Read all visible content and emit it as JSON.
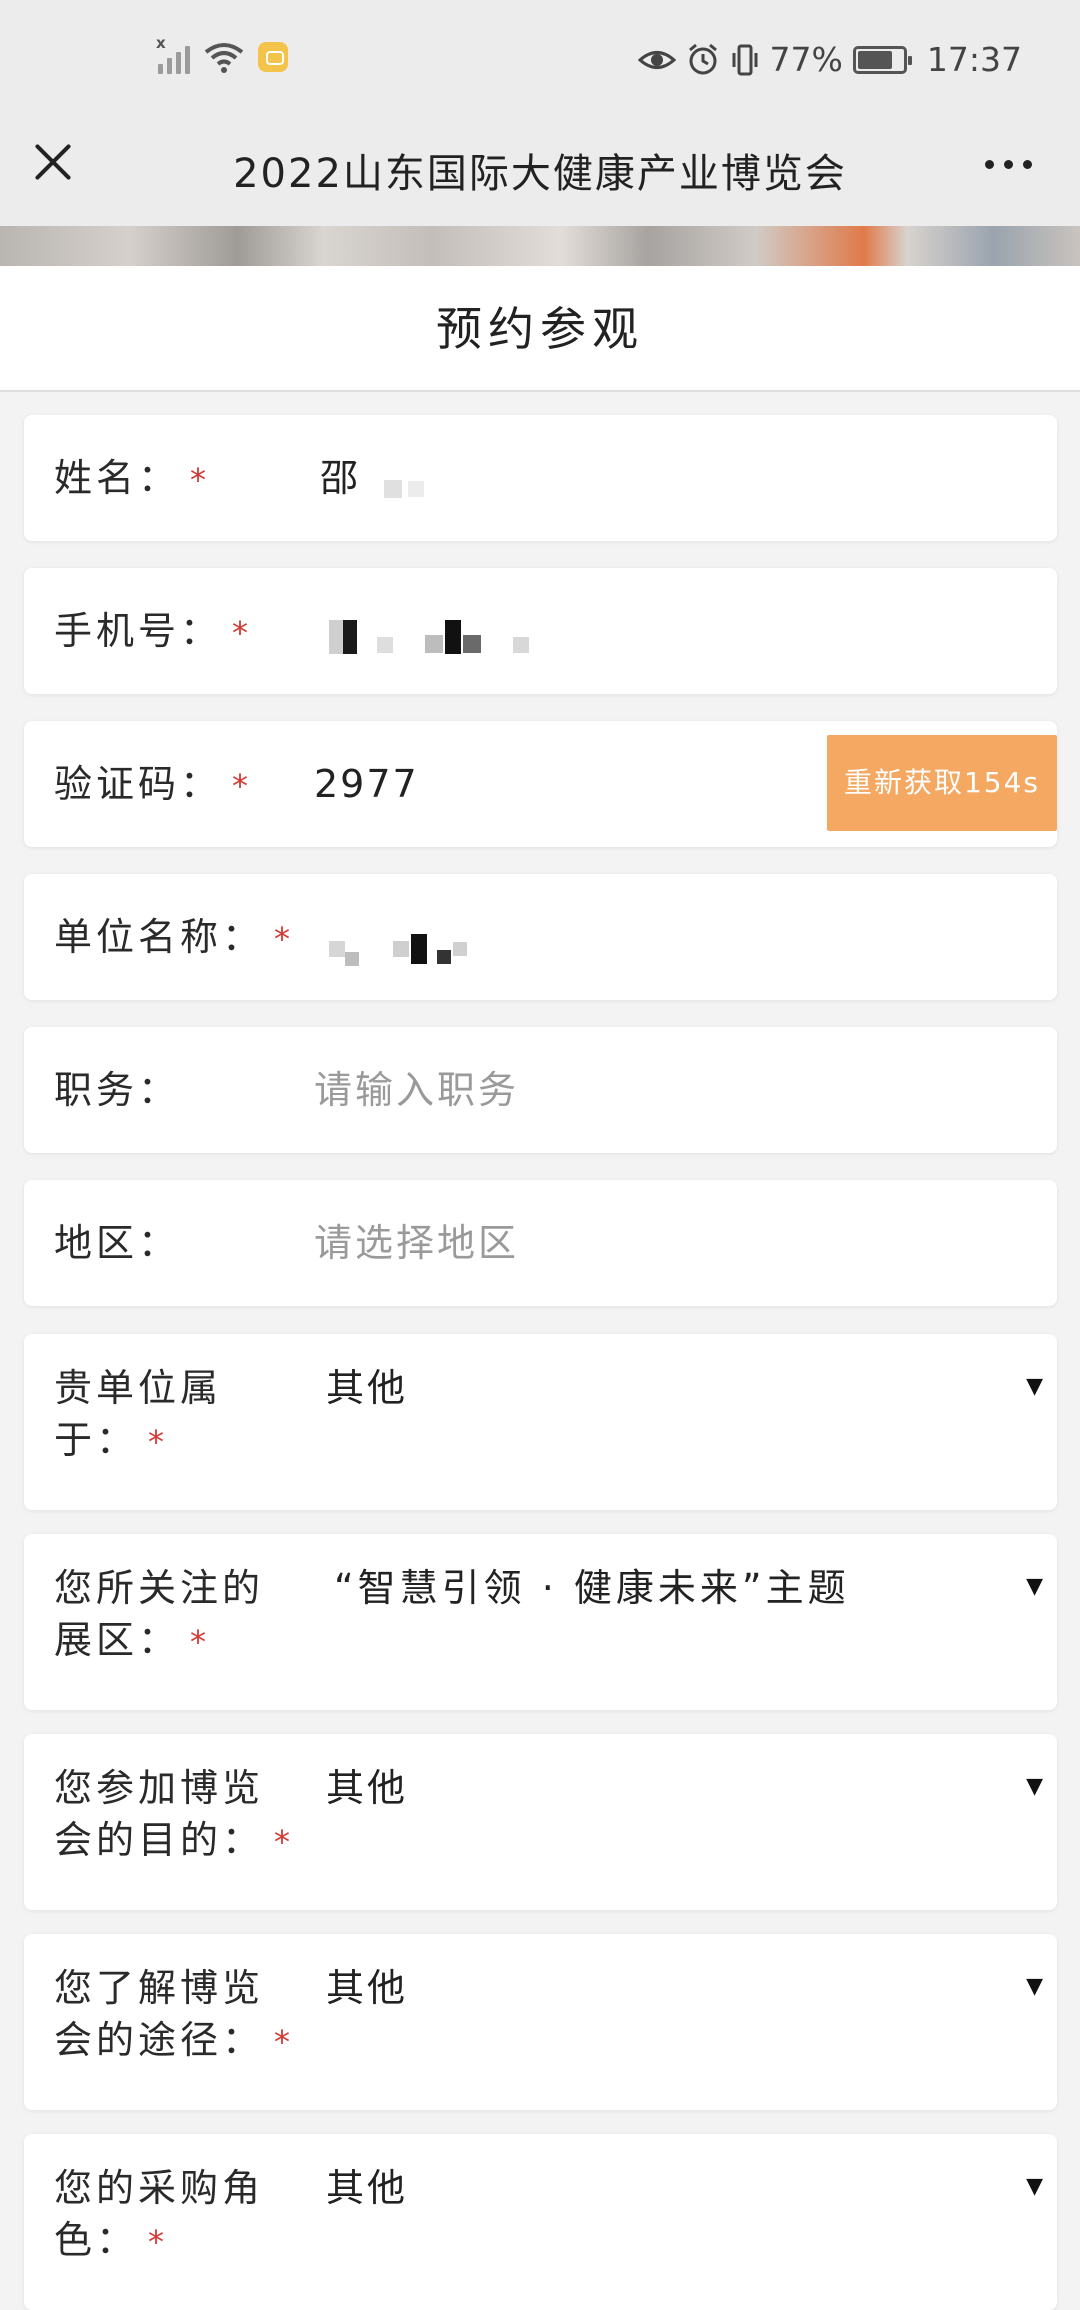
{
  "status_bar": {
    "battery_percent": "77%",
    "time": "17:37",
    "icons": [
      "signal-icon",
      "wifi-icon",
      "notification-icon",
      "eye-icon",
      "alarm-icon",
      "vibrate-icon",
      "battery-icon"
    ]
  },
  "nav": {
    "title": "2022山东国际大健康产业博览会"
  },
  "header": {
    "title": "预约参观"
  },
  "form": {
    "name": {
      "label": "姓名：",
      "required": "*",
      "value": "邵"
    },
    "phone": {
      "label": "手机号：",
      "required": "*"
    },
    "code": {
      "label": "验证码：",
      "required": "*",
      "value": "2977",
      "resend_label": "重新获取154s"
    },
    "company": {
      "label": "单位名称：",
      "required": "*"
    },
    "position": {
      "label": "职务：",
      "placeholder": "请输入职务"
    },
    "region": {
      "label": "地区：",
      "placeholder": "请选择地区"
    },
    "affiliation": {
      "label_line1": "贵单位属",
      "label_line2": "于：",
      "required": "*",
      "value": "其他",
      "caret": "▼"
    },
    "zone": {
      "label_line1": "您所关注的",
      "label_line2": "展区：",
      "required": "*",
      "value": "“智慧引领 · 健康未来”主题",
      "caret": "▼"
    },
    "purpose": {
      "label_line1": "您参加博览",
      "label_line2": "会的目的：",
      "required": "*",
      "value": "其他",
      "caret": "▼"
    },
    "channel": {
      "label_line1": "您了解博览",
      "label_line2": "会的途径：",
      "required": "*",
      "value": "其他",
      "caret": "▼"
    },
    "role": {
      "label_line1": "您的采购角",
      "label_line2": "色：",
      "required": "*",
      "value": "其他",
      "caret": "▼"
    }
  }
}
